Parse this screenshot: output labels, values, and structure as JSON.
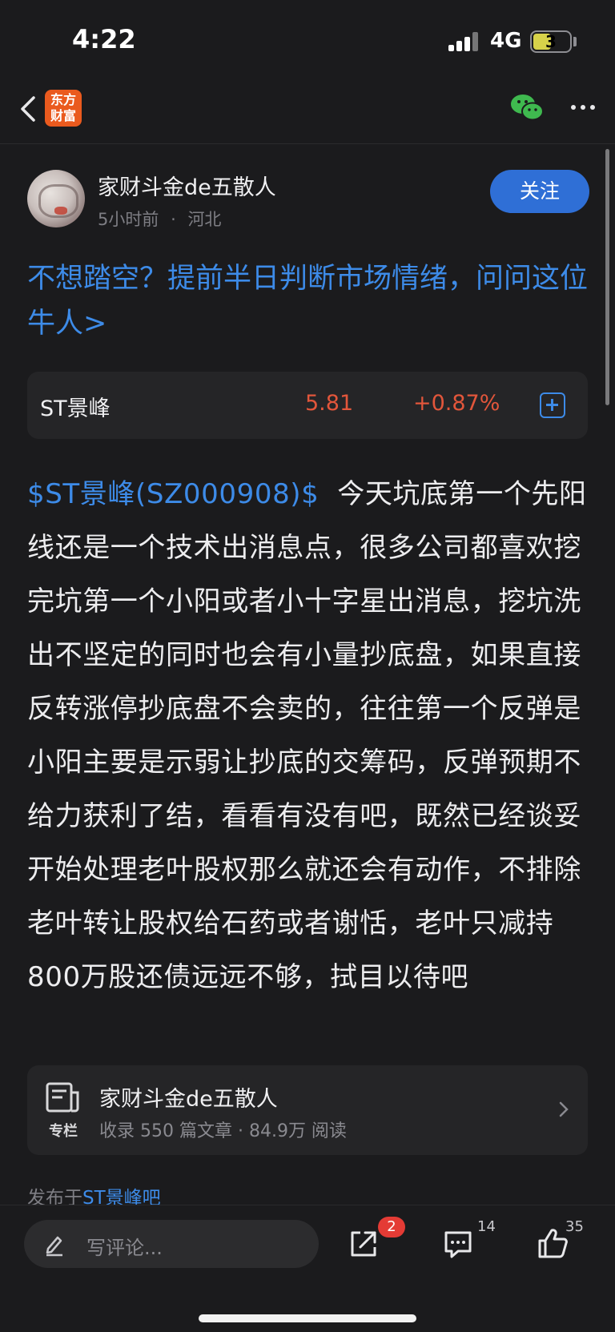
{
  "status_bar": {
    "time": "4:22",
    "network": "4G",
    "battery": "3"
  },
  "nav": {
    "logo_text": "东方财富"
  },
  "author": {
    "name": "家财斗金de五散人",
    "time": "5小时前",
    "separator": "·",
    "location": "河北",
    "follow_label": "关注"
  },
  "promo": {
    "text": "不想踏空？提前半日判断市场情绪，问问这位牛人>"
  },
  "stock": {
    "name": "ST景峰",
    "price": "5.81",
    "change": "+0.87%"
  },
  "post": {
    "ticker": "$ST景峰(SZ000908)$",
    "text": "  今天坑底第一个先阳线还是一个技术出消息点，很多公司都喜欢挖完坑第一个小阳或者小十字星出消息，挖坑洗出不坚定的同时也会有小量抄底盘，如果直接反转涨停抄底盘不会卖的，往往第一个反弹是小阳主要是示弱让抄底的交筹码，反弹预期不给力获利了结，看看有没有吧，既然已经谈妥开始处理老叶股权那么就还会有动作，不排除老叶转让股权给石药或者谢恬，老叶只减持800万股还债远远不够，拭目以待吧"
  },
  "column": {
    "icon_label": "专栏",
    "title": "家财斗金de五散人",
    "stats": "收录 550 篇文章 · 84.9万 阅读"
  },
  "published": {
    "prefix": "发布于",
    "bar": "ST景峰吧"
  },
  "bottom_bar": {
    "comment_placeholder": "写评论...",
    "share_badge": "2",
    "comment_count": "14",
    "like_count": "35"
  }
}
